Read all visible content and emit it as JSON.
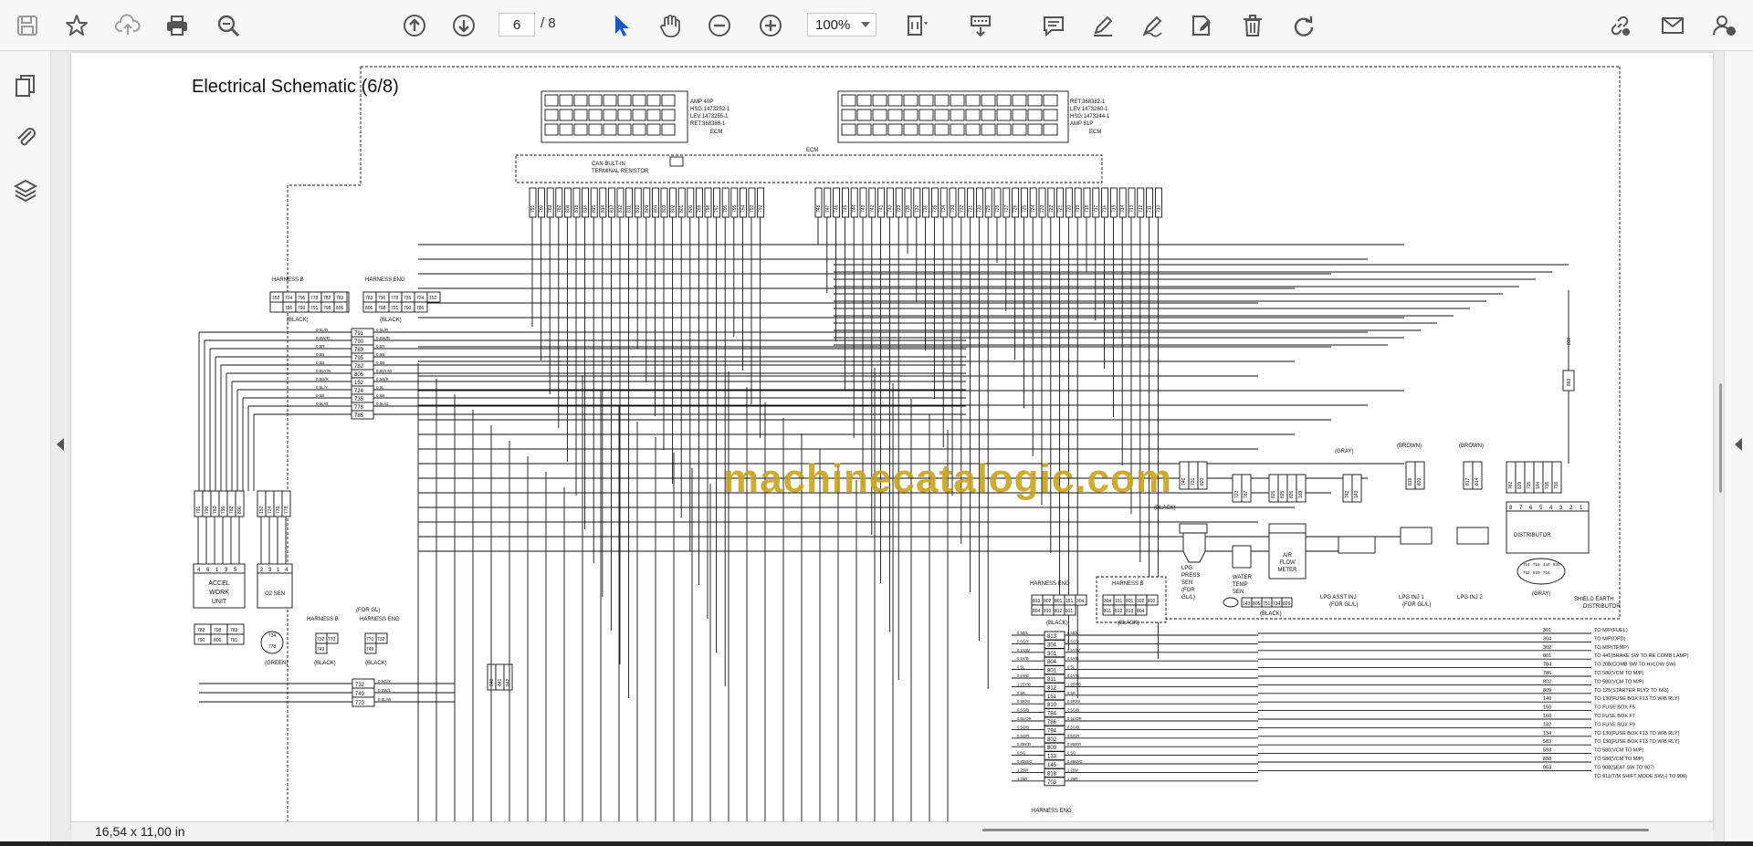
{
  "toolbar": {
    "page_current": "6",
    "page_total": "/ 8",
    "zoom": "100%"
  },
  "status": {
    "dimensions": "16,54 x 11,00 in"
  },
  "schematic": {
    "title": "Electrical Schematic (6/8)",
    "watermark": "machinecatalogic.com",
    "labels": {
      "ecm": "ECM",
      "can": "CAN BULT-IN",
      "term": "TERMINAL RESISTOR",
      "amp40": "AMP 40P",
      "hsg1": "HSG:1473252-1",
      "lev1": "LEV:1473255-1",
      "ret1": "RET:368388-1",
      "ret2": "RET:368382-1",
      "lev2": "LEV:1473260-1",
      "hsg2": "HSG:1473244-1",
      "amp81": "AMP 81P",
      "harness_b": "HARNESS B",
      "harness_eng": "HARNESS ENG",
      "black": "(BLACK)",
      "gray": "(GRAY)",
      "brown": "(BROWN)",
      "green": "(GREEN)",
      "accel": "ACCEL",
      "work": "WORK",
      "unit": "UNIT",
      "o2": "O2 SEN",
      "for_gl": "(FOR GL)",
      "lpg_press": "LPG",
      "press": "PRESS",
      "sen": "SEN",
      "for": "(FOR",
      "gl": "GL/L)",
      "water": "WATER",
      "temp": "TEMP",
      "air": "AIR",
      "flow": "FLOW",
      "meter": "METER",
      "lpg_asst": "LPG ASST INJ",
      "for_gl2": "(FOR GL/L)",
      "inj1": "LPG INJ 1",
      "for_gll": "(FOR GL/L)",
      "inj2": "LPG INJ 2",
      "distributor": "DISTRIBUTOR",
      "shield": "SHIELD EARTH",
      "dist2": "DISTRIBUTOR"
    },
    "ecm_pins_a": [
      "791",
      "790",
      "783",
      "782",
      "808",
      "818",
      "816",
      "815",
      "814",
      "813",
      "812",
      "811",
      "810",
      "809",
      "804",
      "803",
      "802",
      "801",
      "800",
      "799",
      "798",
      "797",
      "796",
      "795",
      "794",
      "793",
      "792"
    ],
    "ecm_pins_b": [
      "748",
      "747",
      "746",
      "745",
      "744",
      "743",
      "742",
      "741",
      "740",
      "739",
      "738",
      "737",
      "736",
      "735",
      "734",
      "733",
      "732",
      "731",
      "730",
      "729",
      "728",
      "727",
      "726",
      "725",
      "724",
      "723",
      "722",
      "721",
      "720",
      "719",
      "718",
      "717",
      "716",
      "715",
      "714",
      "713",
      "712",
      "711",
      "710"
    ],
    "hb_conn_top": [
      "152",
      "724",
      "795",
      "778",
      "782",
      "783"
    ],
    "hb_conn_bot": [
      "786",
      "790",
      "791",
      "798",
      "806"
    ],
    "he_conn_top": [
      "783",
      "790",
      "778",
      "735",
      "724",
      "152"
    ],
    "he_conn_bot": [
      "806",
      "798",
      "791",
      "790",
      "786"
    ],
    "splice_pins": [
      "791",
      "790",
      "783",
      "795",
      "782",
      "806",
      "152",
      "724",
      "735",
      "778",
      "785"
    ],
    "splice_wires_l": [
      "0.5L/R",
      "0.5W/R",
      "0.5R",
      "0.5B",
      "0.5B",
      "0.85Y/R",
      "0.5B/R",
      "0.5L/Y",
      "0.5B",
      "0.5L/G"
    ],
    "splice_wires_r": [
      "0.5L/R",
      "0.5W/R",
      "0.5R",
      "0.5B",
      "0.5B",
      "0.85Y/W",
      "0.5B/R",
      "0.5L",
      "0.5B",
      "0.5L/G"
    ],
    "accel_pins": [
      "791",
      "790",
      "783",
      "795",
      "782",
      "806"
    ],
    "accel_terms": [
      "4",
      "6",
      "1",
      "3",
      "5"
    ],
    "o2_pins": [
      "152",
      "724",
      "735",
      "778"
    ],
    "o2_terms": [
      "2",
      "3",
      "1",
      "4"
    ],
    "box_a": [
      "782",
      "798",
      "783",
      "790",
      "806",
      "791"
    ],
    "small_conn_b": [
      "732",
      "770",
      "749"
    ],
    "small_conn_e": [
      "770",
      "732",
      "749"
    ],
    "lower_splice": [
      "732",
      "749",
      "770"
    ],
    "lower_wires": [
      "0.5G/Y",
      "0.5W/L",
      "0.5L/W"
    ],
    "mid_pins": [
      "840",
      "841",
      "842"
    ],
    "eng_conn_top": [
      "813",
      "802",
      "801",
      "151",
      "304"
    ],
    "eng_conn_bot": [
      "804",
      "810",
      "812",
      "811"
    ],
    "hb2_conn_top": [
      "304",
      "151",
      "801",
      "302",
      "810"
    ],
    "hb2_conn_bot": [
      "811",
      "812",
      "813",
      "804"
    ],
    "center_pins": [
      "813",
      "304",
      "301",
      "804",
      "801",
      "811",
      "812",
      "151",
      "810",
      "784",
      "786",
      "794",
      "802",
      "809",
      "133",
      "145",
      "818",
      "703"
    ],
    "center_wires_l": [
      "0.5B/L",
      "0.5G/Y",
      "0.5Y/W",
      "0.5Y/B",
      "0.5L",
      "0.5Y/G",
      "1.25Y/B",
      "0.5R",
      "0.5R/W",
      "0.5G/B",
      "0.5L/OR",
      "0.5G/B",
      "0.5G/R",
      "0.85Y/R",
      "0.5G",
      "0.85W/G",
      "1.25W",
      "1.25R"
    ],
    "center_wires_r": [
      "0.5B/L",
      "0.5G/Y",
      "0.5Y/W",
      "0.5Y/B",
      "0.5L",
      "0.5Y/G",
      "1.25Y/B",
      "0.5R",
      "0.5R/W",
      "0.5G/B",
      "0.5L/OR",
      "0.5G/B",
      "0.5G/R",
      "0.85Y/R",
      "0.5G",
      "0.85W/G",
      "1.25W",
      "1.25R"
    ],
    "dest_nums": [
      "301",
      "304",
      "302",
      "801",
      "784",
      "786",
      "802",
      "809",
      "140",
      "150",
      "160",
      "132",
      "134",
      "583",
      "593",
      "838",
      "953"
    ],
    "dest_texts": [
      "TO M/P(FUEL)",
      "TO M/P(OPD)",
      "TO M/P(TEMP)",
      "TO 441(BRAKE SW TO RE COMB LAMP)",
      "TO 208(COMB SW TO HI/LOW SW)",
      "TO 580(VCM TO M/P)",
      "TO 580(VCM TO M/P)",
      "TO 125(STARTER RLY2 TO 663)",
      "TO 130(FUSE BOX F13 TO W/B RLY)",
      "TO FUSE BOX F5",
      "TO FUSE BOX F7",
      "TO FUSE BOX F9",
      "TO 130(FUSE BOX F13 TO W/B RLY)",
      "TO 130(FUSE BOX F13 TO W/B RLY)",
      "TO 580(VCM TO M/P)",
      "TO 580(VCM TO M/P)",
      "TO 908(SEAT SW TO 907)",
      "TO 911(T/M SHIFT MODE SW(-) TO 906)"
    ],
    "lpg_press_pins": [
      "746",
      "731",
      "820"
    ],
    "water_pins": [
      "722",
      "767"
    ],
    "air_pins": [
      "826",
      "825",
      "826",
      "163"
    ],
    "asst_pins": [
      "742",
      "143"
    ],
    "inj1_pins": [
      "819",
      "820"
    ],
    "inj2_pins": [
      "817",
      "814"
    ],
    "dist_pins": [
      "762",
      "829",
      "715",
      "144",
      "716",
      "716"
    ],
    "dist_terms": [
      "8",
      "7",
      "6",
      "5",
      "4",
      "3",
      "2",
      "1"
    ],
    "dist_bot_pins": [
      "714",
      "715",
      "144",
      "830",
      "762",
      "829",
      "716"
    ],
    "shield_pins": [
      "143",
      "805",
      "751",
      "734",
      "826"
    ],
    "misc_conn": [
      "748",
      "731",
      "820"
    ],
    "conn_270": [
      "170",
      "172"
    ],
    "conn_141": [
      "141",
      "142"
    ],
    "conn_815": [
      "815",
      "816"
    ],
    "conn_817": [
      "817",
      "818"
    ],
    "harness_eng_bottom": "HARNESS ENG",
    "harness_b_small": "HARNESS B",
    "node_830": "830",
    "node_883": "883",
    "green_conn": [
      "724",
      "735",
      "778",
      "152"
    ]
  }
}
